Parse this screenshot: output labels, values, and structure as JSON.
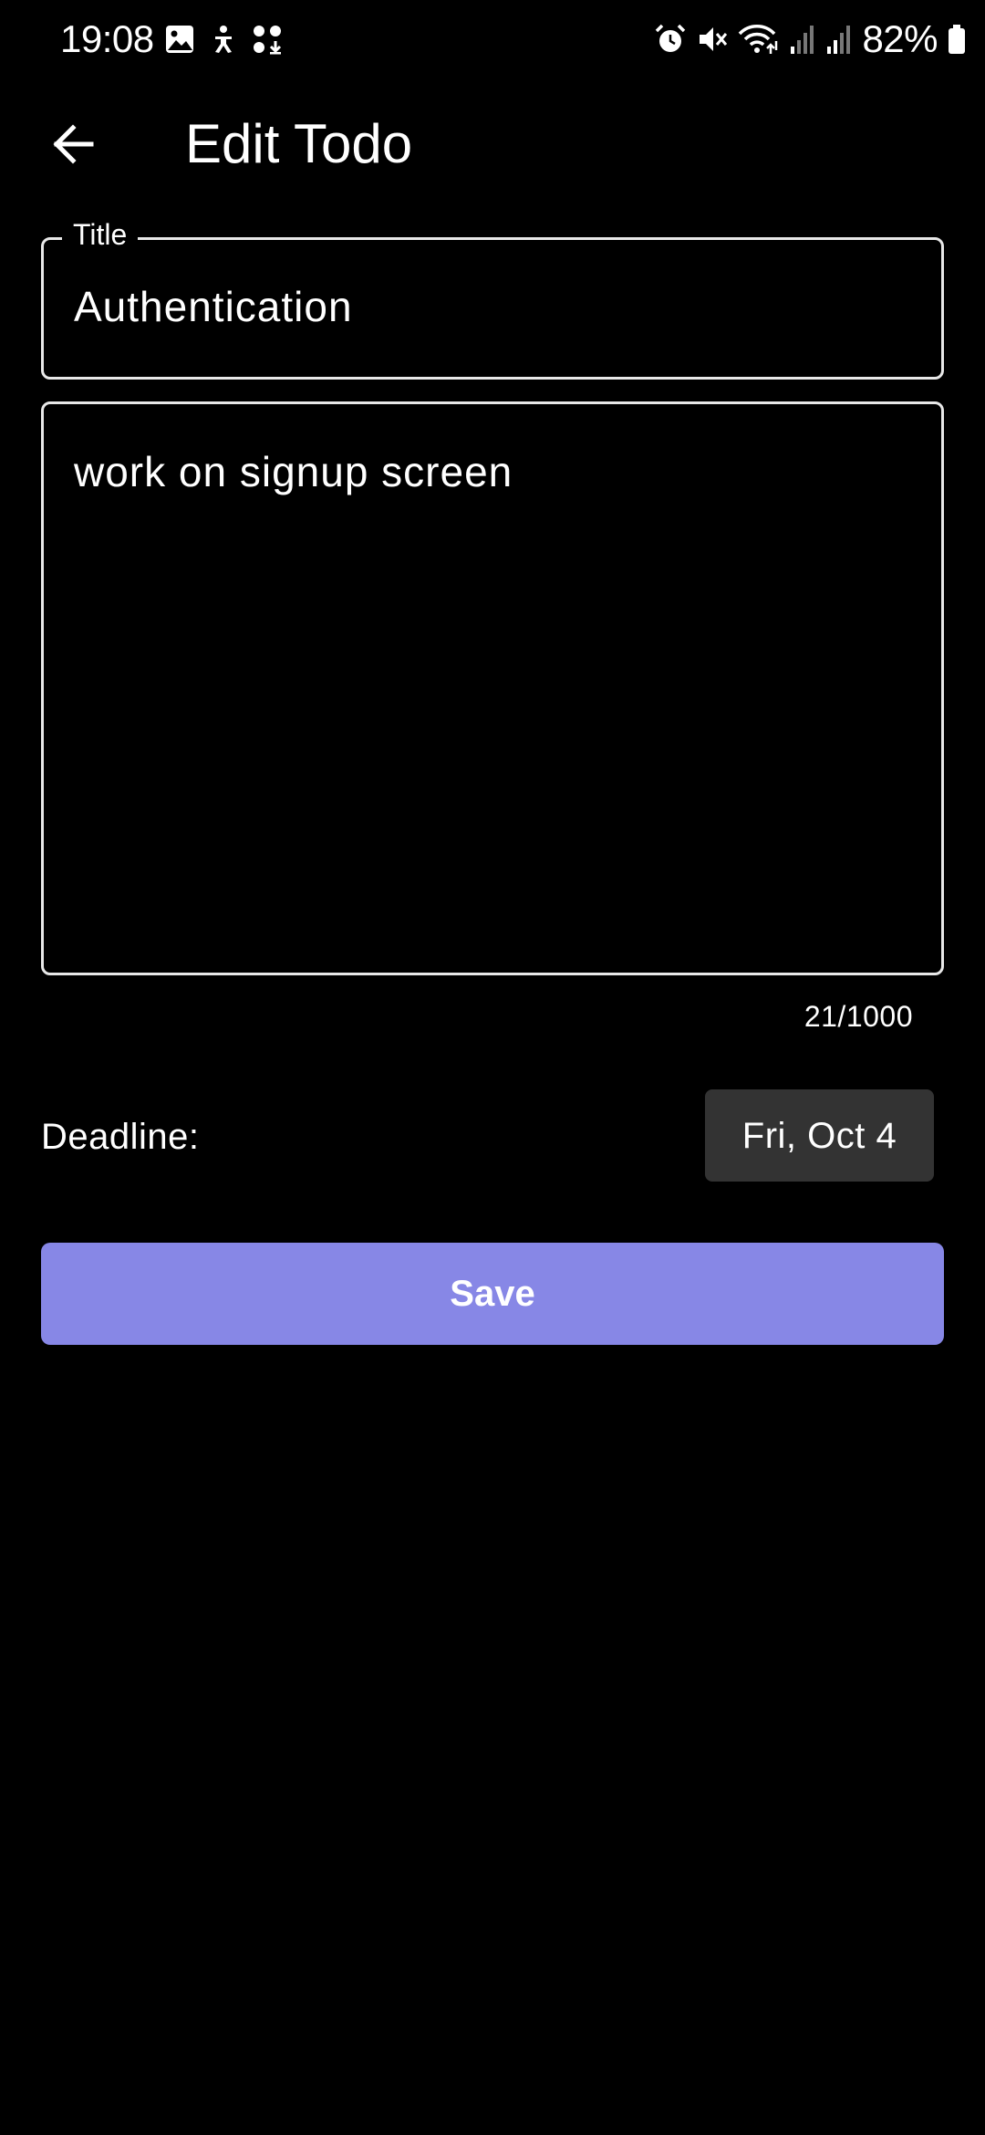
{
  "status_bar": {
    "time": "19:08",
    "battery_percent": "82%",
    "left_icons": [
      "gallery-icon",
      "accessibility-icon",
      "app-grid-download-icon"
    ],
    "right_icons": [
      "alarm-icon",
      "mute-icon",
      "wifi-icon",
      "signal-icon",
      "signal-icon",
      "battery-icon"
    ]
  },
  "app_bar": {
    "back_icon": "arrow-back-icon",
    "title": "Edit Todo"
  },
  "form": {
    "title_field": {
      "label": "Title",
      "value": "Authentication"
    },
    "description_field": {
      "value": "work on signup screen",
      "counter": "21/1000"
    },
    "deadline": {
      "label": "Deadline:",
      "value": "Fri, Oct 4"
    },
    "save_label": "Save"
  },
  "colors": {
    "background": "#000000",
    "text": "#ffffff",
    "field_border": "#e8e8e8",
    "deadline_button_bg": "#333333",
    "save_button_bg": "#8787e6"
  }
}
